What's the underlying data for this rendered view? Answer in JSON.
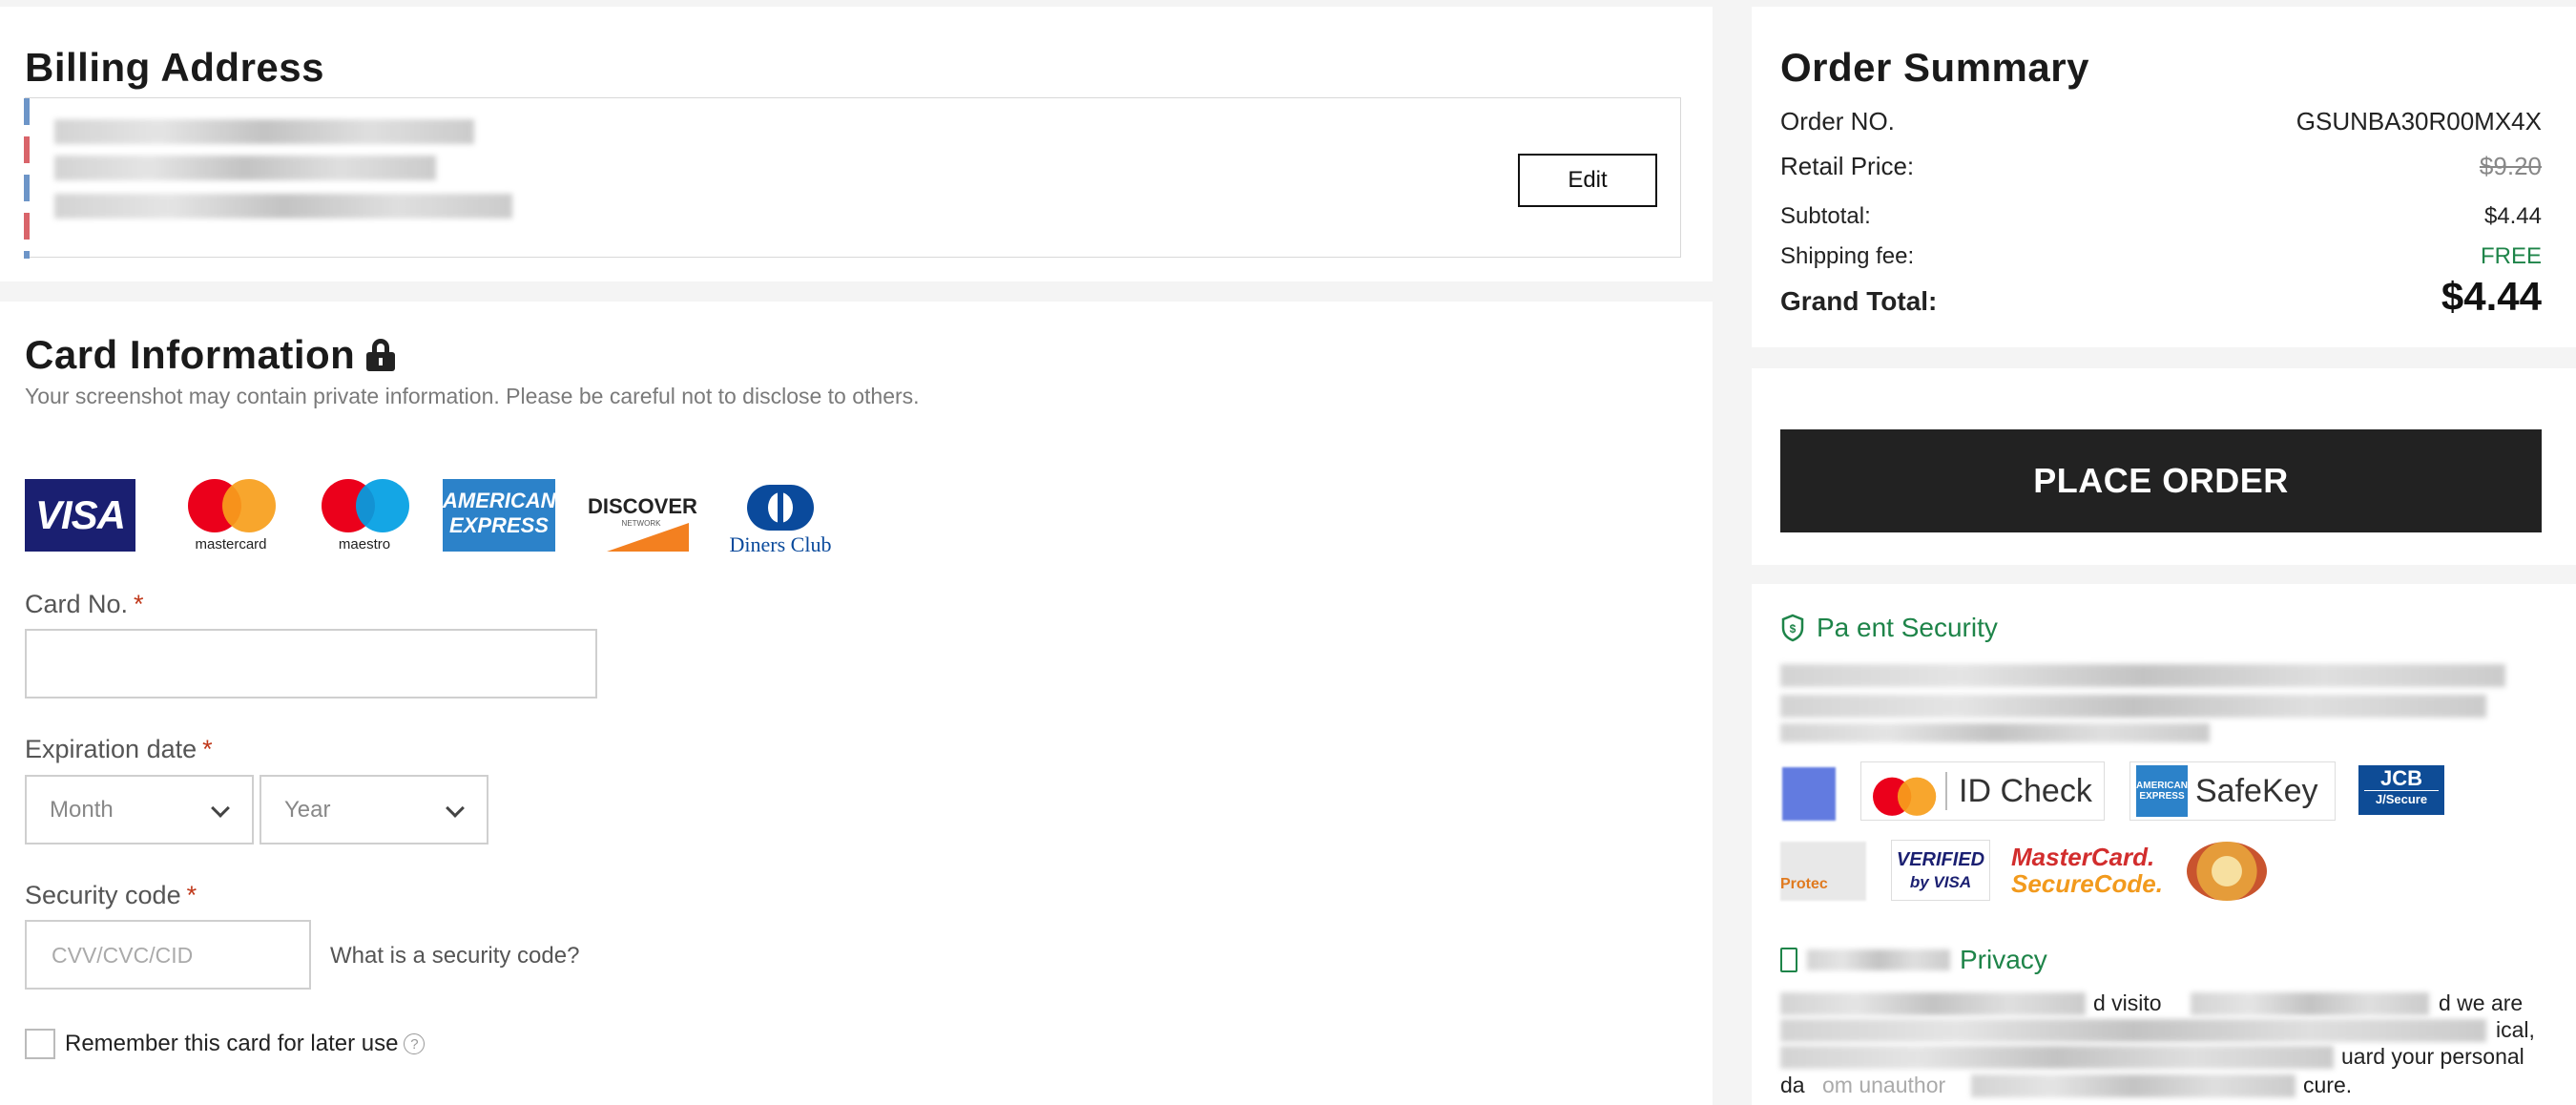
{
  "billing": {
    "title": "Billing Address",
    "edit_label": "Edit"
  },
  "card": {
    "title": "Card Information",
    "notice": "Your screenshot may contain private information. Please be careful not to disclose to others.",
    "logos": {
      "visa": "VISA",
      "mastercard": "mastercard",
      "maestro": "maestro",
      "amex": "AMERICAN EXPRESS",
      "discover": "DISCOVER",
      "discover_sub": "NETWORK",
      "diners": "Diners Club"
    },
    "card_no_label": "Card No.",
    "required_mark": "*",
    "expiration_label": "Expiration date",
    "month_value": "Month",
    "year_value": "Year",
    "security_label": "Security code",
    "security_placeholder": "CVV/CVC/CID",
    "security_help": "What is a security code?",
    "remember_label": "Remember this card for later use",
    "help_glyph": "?"
  },
  "summary": {
    "title": "Order Summary",
    "order_no_label": "Order NO.",
    "order_no": "GSUNBA30R00MX4X",
    "retail_label": "Retail Price:",
    "retail_value": "$9.20",
    "subtotal_label": "Subtotal:",
    "subtotal_value": "$4.44",
    "shipping_label": "Shipping fee:",
    "shipping_value": "FREE",
    "grand_label": "Grand Total:",
    "grand_value": "$4.44"
  },
  "order": {
    "place_label": "PLACE ORDER"
  },
  "security": {
    "title": "Pa   ent Security",
    "badges": {
      "idcheck": "ID Check",
      "safekey": "SafeKey",
      "amex_small": "AMERICAN EXPRESS",
      "jcb": "JCB",
      "jcb_sub": "J/Secure",
      "vbv_top": "VERIFIED",
      "vbv_bottom": "by VISA",
      "msc_top": "MasterCard.",
      "msc_bottom": "SecureCode.",
      "protect": "Protec"
    },
    "privacy_title": "Privacy",
    "privacy_text_1": "d visito",
    "privacy_text_2": "d we are",
    "privacy_text_3": "ical,",
    "privacy_text_4": "uard your personal",
    "privacy_text_5": "da",
    "privacy_text_6": "om unauthor",
    "privacy_text_7": "cure."
  },
  "colors": {
    "accent_green": "#1e8449",
    "required_red": "#c0391b",
    "button_dark": "#222222"
  }
}
